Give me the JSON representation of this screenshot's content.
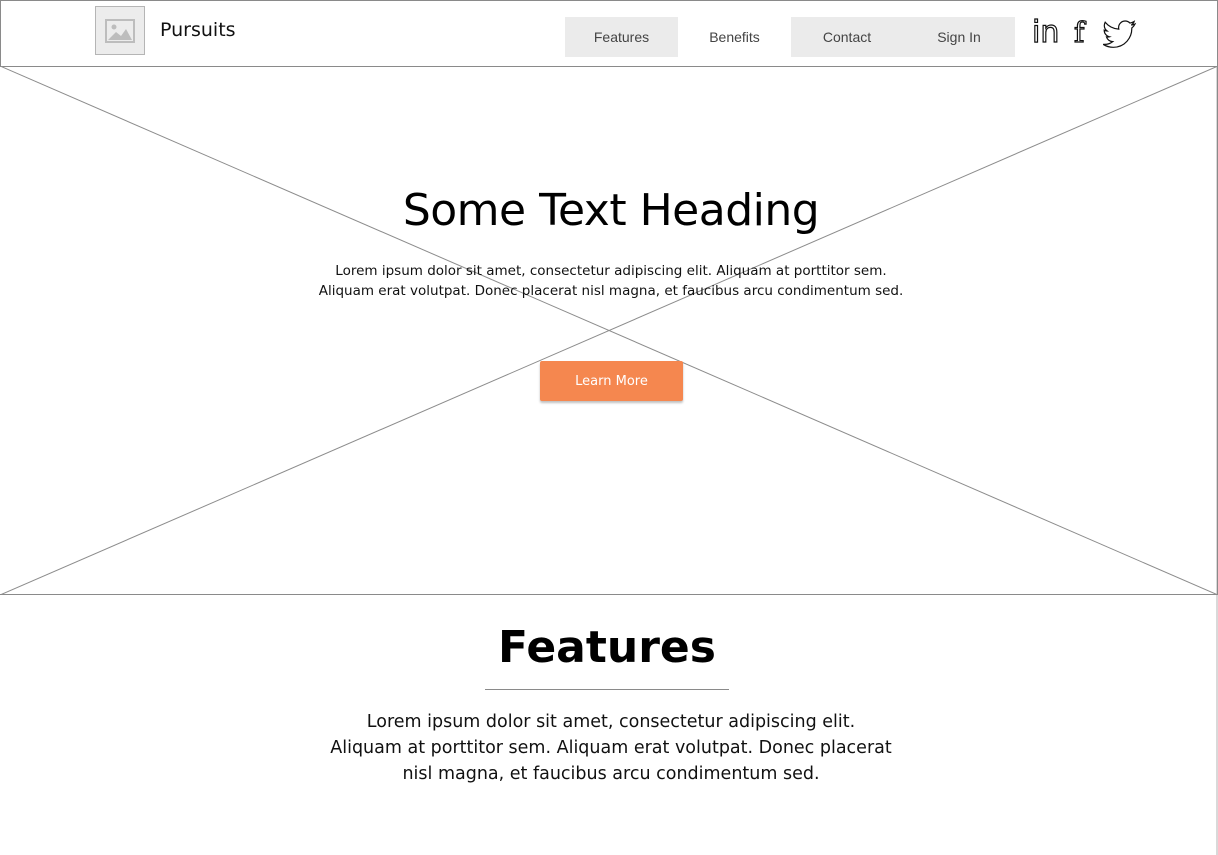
{
  "header": {
    "brand": "Pursuits",
    "nav": [
      "Features",
      "Benefits",
      "Contact",
      "Sign In"
    ],
    "social": [
      "linkedin-icon",
      "facebook-icon",
      "twitter-icon"
    ],
    "linkedin_text": "in",
    "facebook_text": "f"
  },
  "hero": {
    "title": "Some Text Heading",
    "body_lines": [
      "Lorem ipsum dolor sit amet, consectetur adipiscing elit. Aliquam at porttitor sem.",
      "Aliquam erat volutpat. Donec placerat nisl magna, et faucibus arcu condimentum sed."
    ],
    "cta_label": "Learn More",
    "cta_color": "#f5874f"
  },
  "features": {
    "title": "Features",
    "body_lines": [
      "Lorem ipsum dolor sit amet, consectetur adipiscing elit.",
      "Aliquam at porttitor sem. Aliquam erat volutpat. Donec placerat",
      "nisl magna, et faucibus arcu condimentum sed."
    ]
  }
}
